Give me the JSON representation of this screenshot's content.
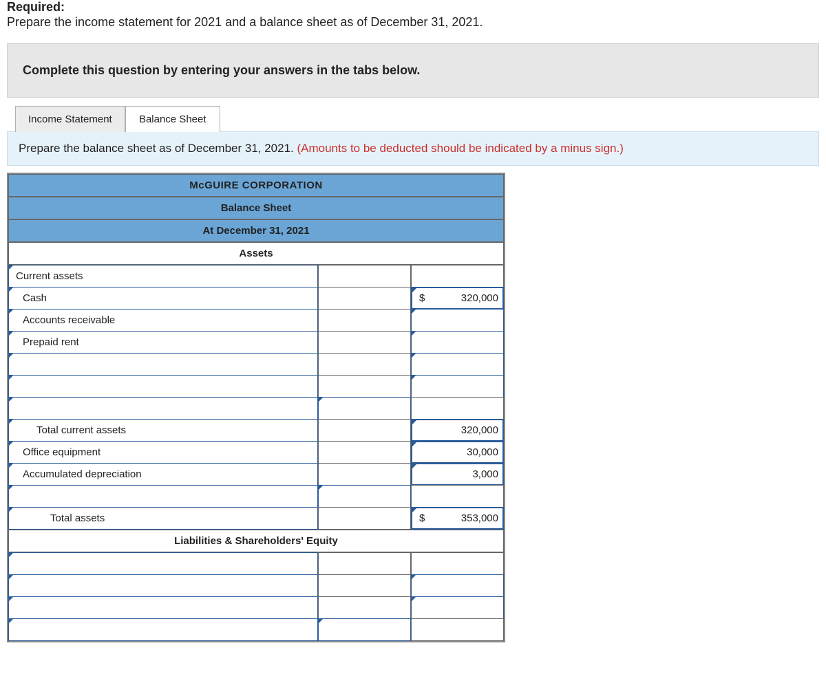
{
  "header": {
    "required": "Required:",
    "prepare": "Prepare the income statement for 2021 and a balance sheet as of December 31, 2021."
  },
  "instruction_bar": "Complete this question by entering your answers in the tabs below.",
  "tabs": {
    "income": "Income Statement",
    "balance": "Balance Sheet"
  },
  "instruction2": {
    "part1": "Prepare the balance sheet as of December 31, 2021. ",
    "part2": "(Amounts to be deducted should be indicated by a minus sign.)"
  },
  "sheet": {
    "company": "McGUIRE CORPORATION",
    "title": "Balance Sheet",
    "date": "At December 31, 2021",
    "assets_hdr": "Assets",
    "liab_hdr": "Liabilities & Shareholders' Equity",
    "rows": {
      "current_assets": "Current assets",
      "cash": "Cash",
      "cash_val": "320,000",
      "ar": "Accounts receivable",
      "prepaid": "Prepaid rent",
      "tca": "Total current assets",
      "tca_val": "320,000",
      "office": "Office equipment",
      "office_val": "30,000",
      "accdep": "Accumulated depreciation",
      "accdep_val": "3,000",
      "ta": "Total assets",
      "ta_val": "353,000",
      "dollar": "$"
    }
  }
}
